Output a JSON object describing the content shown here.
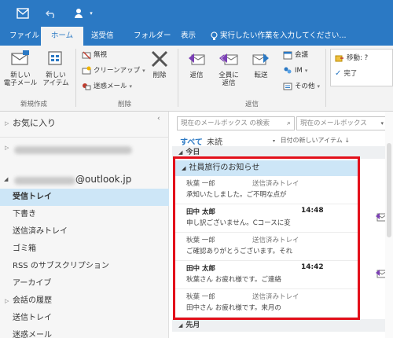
{
  "titlebar": {
    "icons": [
      "outlook-icon",
      "undo-icon",
      "account-icon",
      "dropdown-icon"
    ]
  },
  "tabs": [
    {
      "label": "ファイル",
      "active": false
    },
    {
      "label": "ホーム",
      "active": true
    },
    {
      "label": "送受信",
      "active": false
    },
    {
      "label": "フォルダー",
      "active": false
    },
    {
      "label": "表示",
      "active": false
    }
  ],
  "tellme": {
    "label": "実行したい作業を入力してください..."
  },
  "ribbon": {
    "new_email": "新しい\n電子メール",
    "new_items": "新しい\nアイテム",
    "ignore": "無視",
    "cleanup": "クリーンアップ",
    "junk": "迷惑メール",
    "delete": "削除",
    "reply": "返信",
    "reply_all": "全員に\n返信",
    "forward": "転送",
    "meeting": "会議",
    "im": "IM",
    "more": "その他",
    "move_to": "移動: ?",
    "done": "完了",
    "groups": {
      "new": "新規作成",
      "delete": "削除",
      "respond": "返信"
    }
  },
  "folders": {
    "favorites": "お気に入り",
    "account": "@outlook.jp",
    "items": [
      "受信トレイ",
      "下書き",
      "送信済みトレイ",
      "ゴミ箱",
      "RSS のサブスクリプション",
      "アーカイブ",
      "会話の履歴",
      "送信トレイ",
      "迷惑メール"
    ],
    "collapsed": [
      "会話の履歴"
    ],
    "selected": "受信トレイ"
  },
  "messagelist": {
    "search_placeholder": "現在のメールボックス の検索",
    "scope": "現在のメールボックス",
    "filter_all": "すべて",
    "filter_unread": "未読",
    "sort": "日付の新しいアイテム",
    "group_today": "今日",
    "group_last_month": "先月",
    "conversation_subject": "社員旅行のお知らせ",
    "messages": [
      {
        "from": "秋葉 一郎",
        "meta": "送信済みトレイ",
        "preview": "承知いたしました。ご不明な点が",
        "bold": false,
        "icon": false
      },
      {
        "from": "田中 太郎",
        "meta": "14:48",
        "preview": "申し訳ございません。Cコースに変",
        "bold": true,
        "icon": true
      },
      {
        "from": "秋葉 一郎",
        "meta": "送信済みトレイ",
        "preview": "ご確認ありがとうございます。それ",
        "bold": false,
        "icon": false
      },
      {
        "from": "田中 太郎",
        "meta": "14:42",
        "preview": "秋葉さん お疲れ様です。ご連絡",
        "bold": true,
        "icon": true
      },
      {
        "from": "秋葉 一郎",
        "meta": "送信済みトレイ",
        "preview": "田中さん お疲れ様です。来月の",
        "bold": false,
        "icon": false
      }
    ]
  },
  "colors": {
    "accent": "#2b79c4",
    "selection": "#cde6f7",
    "highlight": "#e3101b"
  }
}
